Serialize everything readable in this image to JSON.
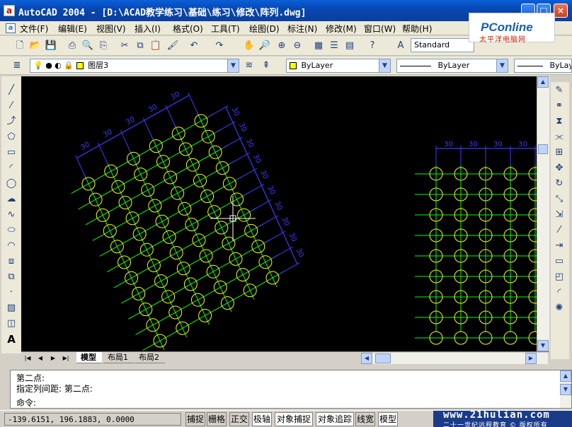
{
  "window": {
    "title": "AutoCAD 2004 - [D:\\ACAD教学练习\\基础\\练习\\修改\\阵列.dwg]",
    "minimize": "_",
    "maximize": "□",
    "close": "×"
  },
  "logo": {
    "name": "PConline",
    "tagline": "太平洋电脑网"
  },
  "menu": [
    "文件(F)",
    "编辑(E)",
    "视图(V)",
    "插入(I)",
    "格式(O)",
    "工具(T)",
    "绘图(D)",
    "标注(N)",
    "修改(M)",
    "窗口(W)",
    "帮助(H)"
  ],
  "standard_toolbar": {
    "text_style": "Standard"
  },
  "layers_toolbar": {
    "current_layer": "图层3",
    "color": "ByLayer",
    "linetype": "ByLayer",
    "lineweight": "ByLayer"
  },
  "dimensions": {
    "left_array_label": "30",
    "right_array_label": "30"
  },
  "tabs": {
    "model": "模型",
    "layout1": "布局1",
    "layout2": "布局2"
  },
  "command_line": {
    "line1": "第二点:",
    "line2": "指定列间距:  第二点:",
    "prompt": "命令:"
  },
  "status": {
    "coordinates": "-139.6151, 196.1883, 0.0000",
    "buttons": [
      {
        "label": "捕捉",
        "on": false
      },
      {
        "label": "栅格",
        "on": false
      },
      {
        "label": "正交",
        "on": false
      },
      {
        "label": "极轴",
        "on": true
      },
      {
        "label": "对象捕捉",
        "on": true
      },
      {
        "label": "对象追踪",
        "on": true
      },
      {
        "label": "线宽",
        "on": false
      },
      {
        "label": "模型",
        "on": true
      }
    ]
  },
  "watermark": {
    "url": "www.21hulian.com",
    "subtitle": "二十一世纪远程教育 © 版权所有"
  },
  "colors": {
    "circle": "#ffff00",
    "centerline": "#00ff00",
    "dimension": "#3c3cff",
    "canvas": "#000000"
  },
  "icons": {
    "standard_toolbar": [
      "new-icon",
      "open-icon",
      "save-icon",
      "print-icon",
      "preview-icon",
      "publish-icon",
      "cut-icon",
      "copy-icon",
      "paste-icon",
      "match-properties-icon",
      "undo-icon",
      "redo-icon",
      "pan-icon",
      "zoom-realtime-icon",
      "zoom-window-icon",
      "zoom-previous-icon",
      "design-center-icon",
      "properties-icon",
      "tool-palette-icon",
      "help-icon"
    ],
    "left_toolbar": [
      "line-icon",
      "construction-line-icon",
      "polyline-icon",
      "polygon-icon",
      "rectangle-icon",
      "arc-icon",
      "circle-icon",
      "revision-cloud-icon",
      "spline-icon",
      "ellipse-icon",
      "ellipse-arc-icon",
      "insert-block-icon",
      "make-block-icon",
      "point-icon",
      "hatch-icon",
      "region-icon",
      "text-icon"
    ],
    "right_toolbar": [
      "erase-icon",
      "copy-object-icon",
      "mirror-icon",
      "offset-icon",
      "array-icon",
      "move-icon",
      "rotate-icon",
      "scale-icon",
      "stretch-icon",
      "trim-icon",
      "extend-icon",
      "break-icon",
      "chamfer-icon",
      "fillet-icon",
      "explode-icon"
    ]
  }
}
